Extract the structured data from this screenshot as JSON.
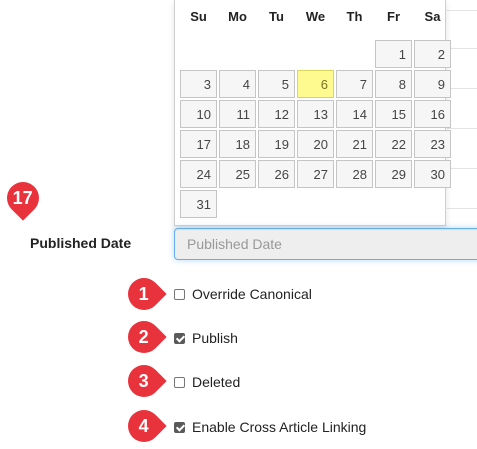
{
  "calendar": {
    "weekdays": [
      "Su",
      "Mo",
      "Tu",
      "We",
      "Th",
      "Fr",
      "Sa"
    ],
    "leading_blanks": 5,
    "days": [
      1,
      2,
      3,
      4,
      5,
      6,
      7,
      8,
      9,
      10,
      11,
      12,
      13,
      14,
      15,
      16,
      17,
      18,
      19,
      20,
      21,
      22,
      23,
      24,
      25,
      26,
      27,
      28,
      29,
      30,
      31
    ],
    "highlighted_day": 6
  },
  "published_date": {
    "label": "Published Date",
    "placeholder": "Published Date",
    "value": ""
  },
  "checkboxes": [
    {
      "marker": "1",
      "label": "Override Canonical",
      "checked": false
    },
    {
      "marker": "2",
      "label": "Publish",
      "checked": true
    },
    {
      "marker": "3",
      "label": "Deleted",
      "checked": false
    },
    {
      "marker": "4",
      "label": "Enable Cross Article Linking",
      "checked": true
    }
  ],
  "annotations": {
    "published_date_marker": "17"
  },
  "colors": {
    "marker": "#e8323c",
    "today_highlight": "#fffa90",
    "focus_border": "#66afe9"
  }
}
